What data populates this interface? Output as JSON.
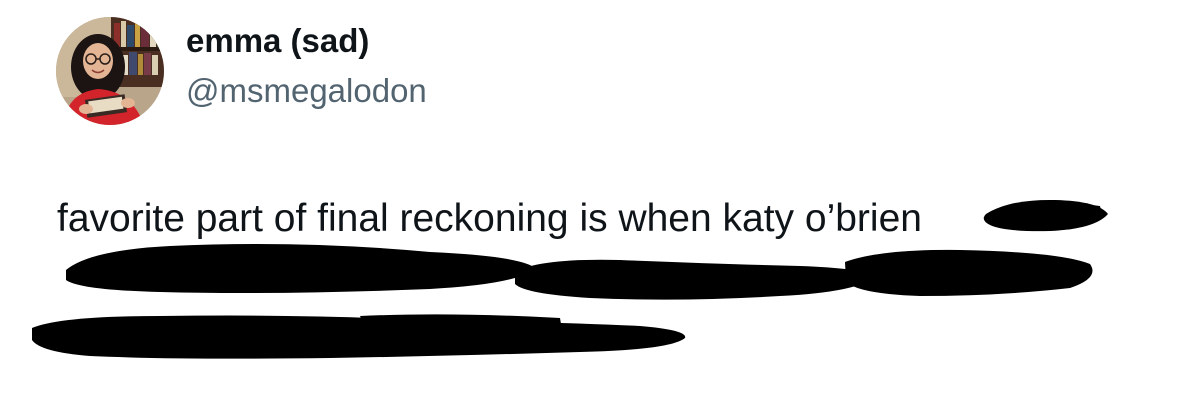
{
  "author": {
    "display_name": "emma (sad)",
    "handle": "@msmegalodon",
    "avatar_icon": "profile-photo"
  },
  "tweet": {
    "lines": [
      "favorite part of final reckoning is when katy o’brien",
      "",
      ""
    ],
    "redaction_color": "#000000"
  },
  "colors": {
    "text": "#0f1419",
    "secondary_text": "#536471",
    "background": "#ffffff"
  }
}
